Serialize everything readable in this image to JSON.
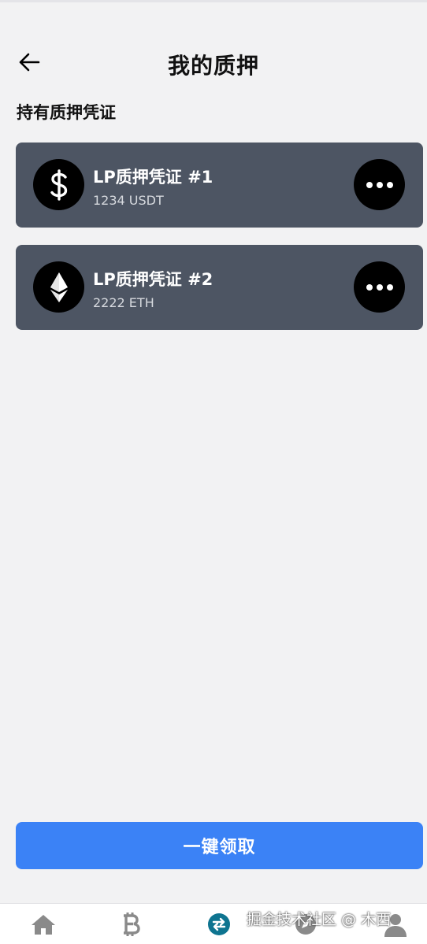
{
  "header": {
    "title": "我的质押",
    "back_icon": "arrow-left-icon"
  },
  "section": {
    "title": "持有质押凭证"
  },
  "cards": [
    {
      "title": "LP质押凭证 #1",
      "amount": "1234 USDT",
      "icon": "dollar-icon"
    },
    {
      "title": "LP质押凭证 #2",
      "amount": "2222 ETH",
      "icon": "ethereum-icon"
    }
  ],
  "actions": {
    "claim_label": "一键领取"
  },
  "nav": {
    "items": [
      {
        "icon": "home-icon"
      },
      {
        "icon": "bitcoin-icon"
      },
      {
        "icon": "swap-icon",
        "active": true
      },
      {
        "icon": "compass-icon"
      },
      {
        "icon": "user-icon"
      }
    ]
  },
  "watermark": "掘金技术社区 @ 木西",
  "colors": {
    "background": "#f2f2f3",
    "card": "#4d5563",
    "primary": "#3b82f6",
    "nav_active": "#0e7490",
    "nav_inactive": "#8a8a8a"
  }
}
